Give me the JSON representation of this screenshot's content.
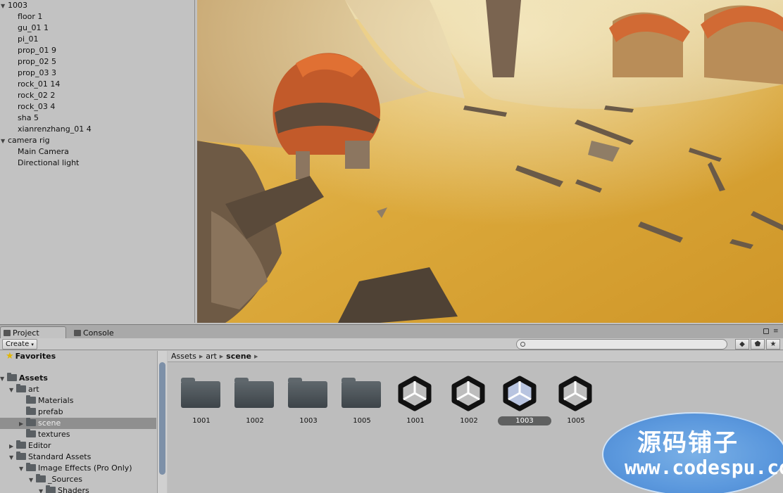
{
  "hierarchy": {
    "items": [
      {
        "label": "1003",
        "level": 0
      },
      {
        "label": "floor 1",
        "level": 1
      },
      {
        "label": "gu_01 1",
        "level": 1
      },
      {
        "label": "pi_01",
        "level": 1
      },
      {
        "label": "prop_01 9",
        "level": 1
      },
      {
        "label": "prop_02 5",
        "level": 1
      },
      {
        "label": "prop_03 3",
        "level": 1
      },
      {
        "label": "rock_01 14",
        "level": 1
      },
      {
        "label": "rock_02 2",
        "level": 1
      },
      {
        "label": "rock_03 4",
        "level": 1
      },
      {
        "label": "sha 5",
        "level": 1
      },
      {
        "label": "xianrenzhang_01 4",
        "level": 1
      },
      {
        "label": "camera rig",
        "level": 0
      },
      {
        "label": "Main Camera",
        "level": 1
      },
      {
        "label": "Directional light",
        "level": 1
      }
    ]
  },
  "tabs": {
    "project": "Project",
    "console": "Console"
  },
  "toolbar": {
    "create": "Create",
    "search_placeholder": ""
  },
  "project_tree": {
    "favorites": "Favorites",
    "assets": "Assets",
    "art": "art",
    "materials": "Materials",
    "prefab": "prefab",
    "scene": "scene",
    "textures": "textures",
    "editor": "Editor",
    "standard_assets": "Standard Assets",
    "image_effects": "Image Effects (Pro Only)",
    "sources": "_Sources",
    "shaders": "Shaders"
  },
  "breadcrumb": {
    "assets": "Assets",
    "art": "art",
    "scene": "scene"
  },
  "assets": [
    {
      "label": "1001",
      "type": "folder"
    },
    {
      "label": "1002",
      "type": "folder"
    },
    {
      "label": "1003",
      "type": "folder"
    },
    {
      "label": "1005",
      "type": "folder"
    },
    {
      "label": "1001",
      "type": "unity-scene"
    },
    {
      "label": "1002",
      "type": "unity-scene"
    },
    {
      "label": "1003",
      "type": "unity-scene",
      "selected": true
    },
    {
      "label": "1005",
      "type": "unity-scene"
    }
  ],
  "watermark": {
    "line1": "源码铺子",
    "line2": "www.codespu.com"
  },
  "colors": {
    "panel": "#c2c2c2",
    "sand": "#d9a53a",
    "roof": "#d2602a",
    "selection": "#8f8f8f"
  }
}
